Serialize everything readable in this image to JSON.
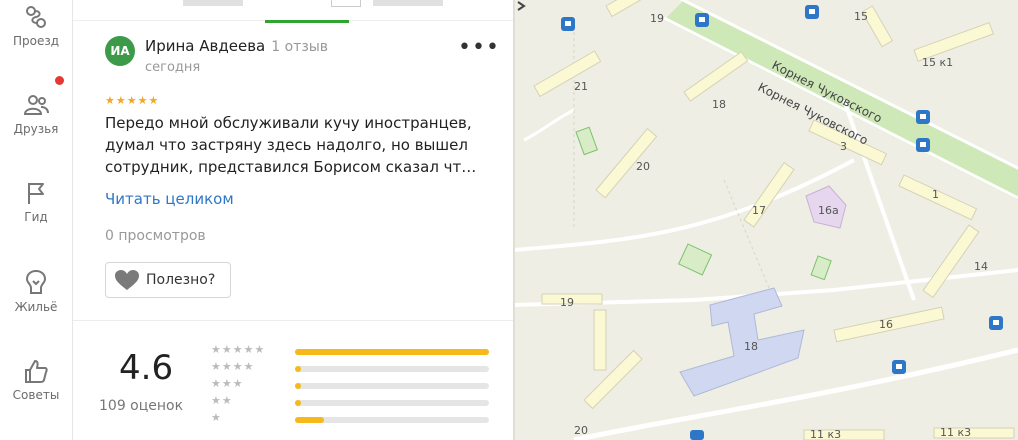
{
  "sidebar": {
    "items": [
      {
        "label": "Проезд",
        "icon": "route-icon"
      },
      {
        "label": "Друзья",
        "icon": "friends-icon",
        "badge": true
      },
      {
        "label": "Гид",
        "icon": "flag-icon"
      },
      {
        "label": "Жильё",
        "icon": "house-icon"
      },
      {
        "label": "Советы",
        "icon": "thumb-up-icon"
      }
    ]
  },
  "review": {
    "avatar_initials": "ИА",
    "author": "Ирина Авдеева",
    "author_reviews": "1 отзыв",
    "date": "сегодня",
    "stars": "★★★★★",
    "text": "Передо мной обслуживали кучу иностранцев, думал что застряну здесь надолго, но вышел сотрудник, представился Борисом сказал чт…",
    "read_more": "Читать целиком",
    "views": "0 просмотров",
    "helpful_label": "Полезно?"
  },
  "summary": {
    "rating": "4.6",
    "count_label": "109 оценок",
    "distribution": [
      {
        "stars": "★★★★★",
        "fraction": 1.0
      },
      {
        "stars": "★★★★",
        "fraction": 0.03
      },
      {
        "stars": "★★★",
        "fraction": 0.03
      },
      {
        "stars": "★★",
        "fraction": 0.03
      },
      {
        "stars": "★",
        "fraction": 0.15
      }
    ]
  },
  "map": {
    "street_1": "Корнея Чуковского",
    "street_2": "Корнея Чуковского",
    "building_labels": [
      "19",
      "15",
      "15 к1",
      "21",
      "18",
      "3",
      "20",
      "17",
      "16а",
      "1",
      "14",
      "19",
      "16",
      "18",
      "20",
      "11 к3",
      "11 к3"
    ]
  },
  "colors": {
    "accent_green": "#2fa52f",
    "link_blue": "#2e77c8",
    "star_orange": "#f5a623",
    "bar_yellow": "#f6b81a",
    "avatar_green": "#3c9a48",
    "school_blue": "#cfd8f0",
    "transit_blue": "#2e77c8"
  }
}
